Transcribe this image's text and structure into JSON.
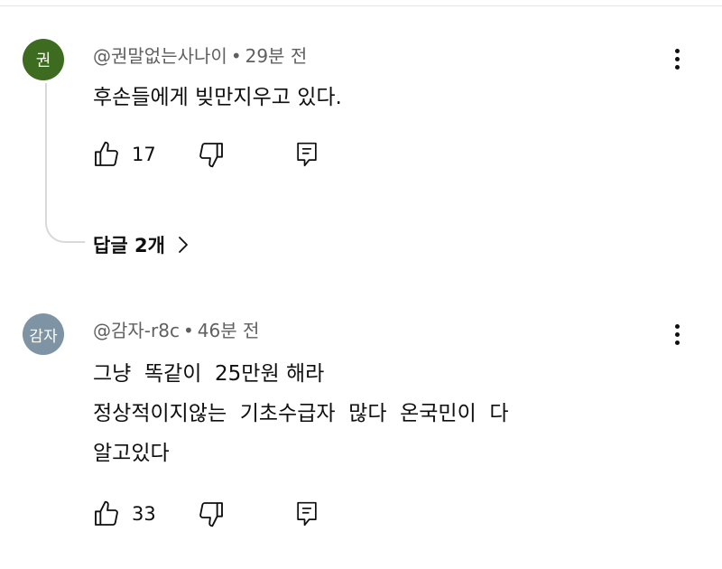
{
  "comments": [
    {
      "avatar_text": "권",
      "avatar_color": "#3d6b1f",
      "author": "@권말없는사나이",
      "separator": "•",
      "time": "29분 전",
      "lines": [
        "후손들에게 빚만지우고 있다."
      ],
      "likes": "17",
      "replies_label": "답글 2개"
    },
    {
      "avatar_text": "감자",
      "avatar_color": "#7e93a3",
      "author": "@감자-r8c",
      "separator": "•",
      "time": "46분 전",
      "lines": [
        "그냥  똑같이  25만원 해라",
        "정상적이지않는  기초수급자  많다  온국민이  다",
        "알고있다"
      ],
      "likes": "33"
    }
  ],
  "icons": {
    "like": "thumbs-up-icon",
    "dislike": "thumbs-down-icon",
    "reply": "reply-icon",
    "more": "more-vertical-icon",
    "replies_chevron": "chevron-right-icon"
  }
}
